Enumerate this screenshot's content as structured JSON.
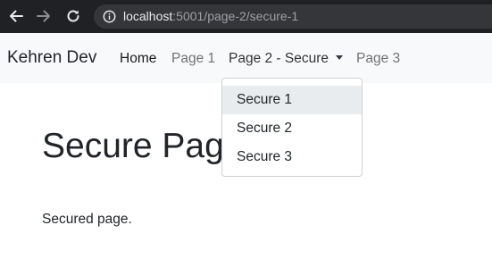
{
  "browser": {
    "url_host": "localhost",
    "url_path": ":5001/page-2/secure-1",
    "icons": [
      "back-arrow-icon",
      "forward-arrow-icon",
      "reload-icon",
      "info-icon"
    ]
  },
  "navbar": {
    "brand": "Kehren Dev",
    "links": [
      {
        "label": "Home"
      },
      {
        "label": "Page 1"
      },
      {
        "label": "Page 2 - Secure"
      },
      {
        "label": "Page 3"
      }
    ]
  },
  "dropdown": {
    "items": [
      {
        "label": "Secure 1"
      },
      {
        "label": "Secure 2"
      },
      {
        "label": "Secure 3"
      }
    ]
  },
  "main": {
    "title": "Secure Page",
    "text": "Secured page."
  },
  "colors": {
    "browser_chrome": "#202124",
    "navbar_bg": "#f8f9fa",
    "dropdown_hover": "#e9ecef",
    "text": "#212529"
  }
}
